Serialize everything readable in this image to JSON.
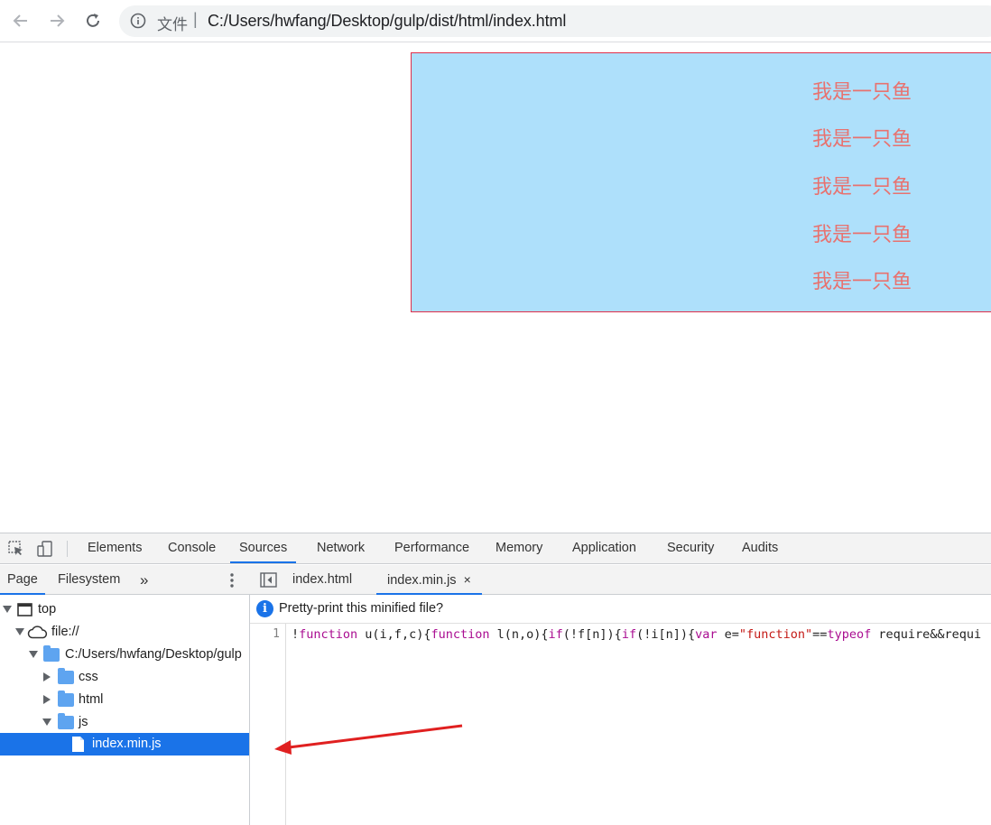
{
  "browser": {
    "scheme_label": "文件",
    "separator": "|",
    "url": "C:/Users/hwfang/Desktop/gulp/dist/html/index.html"
  },
  "page": {
    "lines": [
      "我是一只鱼",
      "我是一只鱼",
      "我是一只鱼",
      "我是一只鱼",
      "我是一只鱼"
    ]
  },
  "devtools": {
    "tabs": [
      "Elements",
      "Console",
      "Sources",
      "Network",
      "Performance",
      "Memory",
      "Application",
      "Security",
      "Audits"
    ],
    "active_tab": "Sources",
    "navigator": {
      "tabs": [
        "Page",
        "Filesystem"
      ],
      "more": "»",
      "tree": {
        "top": "top",
        "origin": "file://",
        "folder": "C:/Users/hwfang/Desktop/gulp",
        "css": "css",
        "html": "html",
        "js": "js",
        "file": "index.min.js"
      }
    },
    "editor": {
      "tabs": [
        "index.html",
        "index.min.js"
      ],
      "close": "×",
      "infobar": "Pretty-print this minified file?",
      "line_number": "1",
      "code": {
        "p1": "!",
        "k1": "function",
        "p2": " u(i,f,c){",
        "k2": "function",
        "p3": " l(n,o){",
        "k3": "if",
        "p4": "(!f[n]){",
        "k4": "if",
        "p5": "(!i[n]){",
        "k5": "var",
        "p6": " e=",
        "s1": "\"function\"",
        "p7": "==",
        "k6": "typeof",
        "p8": " require&&requi"
      }
    }
  },
  "colors": {
    "page_box": "#aee0fb",
    "page_text": "#e8726f",
    "accent": "#1a73e8",
    "annotation_arrow": "#e02020"
  }
}
